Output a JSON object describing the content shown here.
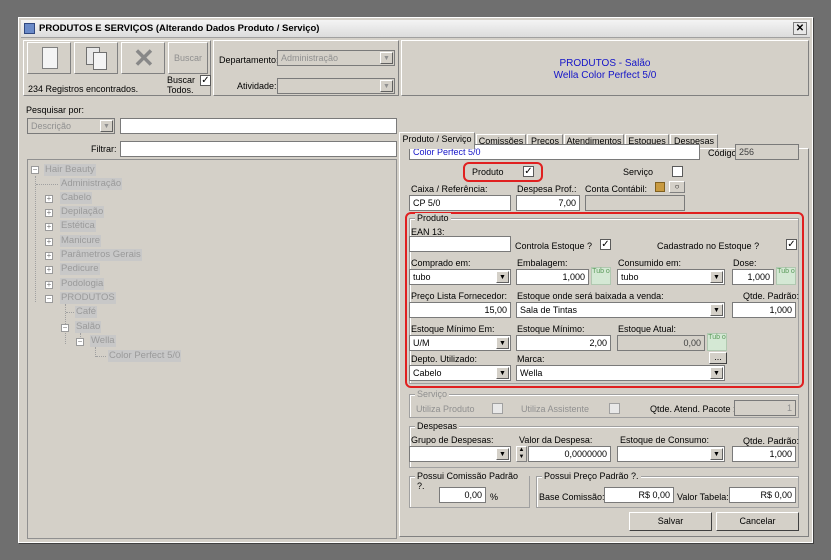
{
  "window": {
    "title": "PRODUTOS E SERVIÇOS (Alterando Dados Produto / Serviço)",
    "close": "✕"
  },
  "toolbar": {
    "search_btn": "Buscar",
    "records": "234 Registros encontrados.",
    "buscar_todos": "Buscar Todos.",
    "departamento_label": "Departamento:",
    "departamento_value": "Administração",
    "atividade_label": "Atividade:",
    "atividade_value": ""
  },
  "header": {
    "line1": "PRODUTOS - Salão",
    "line2": "Wella Color Perfect 5/0"
  },
  "left": {
    "pesquisar_label": "Pesquisar por:",
    "pesquisar_value": "Descrição",
    "search_text": "",
    "filtrar_label": "Filtrar:",
    "filtrar_value": ""
  },
  "tree": {
    "root": "Hair Beauty",
    "items": [
      "Administração",
      "Cabelo",
      "Depilação",
      "Estética",
      "Manicure",
      "Parâmetros Gerais",
      "Pedicure",
      "Podologia",
      "PRODUTOS",
      "Café",
      "Salão",
      "Wella",
      "Color Perfect 5/0"
    ]
  },
  "tabs": [
    "Produto / Serviço",
    "Comissões",
    "Preços",
    "Atendimentos",
    "Estoques",
    "Despesas"
  ],
  "form": {
    "nome": "Color Perfect 5/0",
    "codigo_label": "Código:",
    "codigo": "256",
    "produto_label": "Produto",
    "servico_label": "Serviço",
    "check": "✓",
    "caixa_label": "Caixa / Referência:",
    "caixa": "CP 5/0",
    "despesa_label": "Despesa Prof.:",
    "despesa": "7,00",
    "conta_label": "Conta Contábil:",
    "conta": "",
    "produto_grp": "Produto",
    "ean_label": "EAN 13:",
    "ean": "",
    "controla_label": "Controla Estoque  ?",
    "cadastrado_label": "Cadastrado no Estoque  ?",
    "comprado_label": "Comprado em:",
    "comprado": "tubo",
    "embalagem_label": "Embalagem:",
    "embalagem": "1,000",
    "unit_tubo": "Tub o",
    "consumido_label": "Consumido em:",
    "consumido": "tubo",
    "dose_label": "Dose:",
    "dose": "1,000",
    "preco_label": "Preço Lista Fornecedor:",
    "preco": "15,00",
    "estoque_baixa_label": "Estoque onde será baixada a venda:",
    "estoque_baixa": "Sala de Tintas",
    "qtde_label": "Qtde. Padrão:",
    "qtde": "1,000",
    "est_min_em_label": "Estoque Mínimo Em:",
    "est_min_em": "U/M",
    "est_min_label": "Estoque Mínimo:",
    "est_min": "2,00",
    "est_atual_label": "Estoque Atual:",
    "est_atual": "0,00",
    "depto_label": "Depto. Utilizado:",
    "depto": "Cabelo",
    "marca_label": "Marca:",
    "marca": "Wella",
    "ellipsis": "...",
    "servico_grp": "Serviço",
    "utiliza_produto": "Utiliza Produto",
    "utiliza_assistente": "Utiliza Assistente",
    "qtde_atend_label": "Qtde. Atend. Pacote :",
    "qtde_atend": "1",
    "despesas_grp": "Despesas",
    "grupo_label": "Grupo de Despesas:",
    "grupo": "",
    "valor_label": "Valor da Despesa:",
    "valor": "0,0000000",
    "estoque_consumo_label": "Estoque de Consumo:",
    "estoque_consumo": "",
    "qtde2_label": "Qtde. Padrão:",
    "qtde2": "1,000",
    "comissao_grp": "Possui Comissão Padrão ?.",
    "comissao": "0,00",
    "pct": "%",
    "preco_padrao_grp": "Possui Preço Padrão ?.",
    "base_label": "Base Comissão:",
    "base": "R$ 0,00",
    "valor_tabela_label": "Valor Tabela:",
    "valor_tabela": "R$ 0,00",
    "salvar": "Salvar",
    "cancelar": "Cancelar"
  },
  "colors": {
    "header_text": "#1414c8",
    "highlight": "#e02020"
  }
}
